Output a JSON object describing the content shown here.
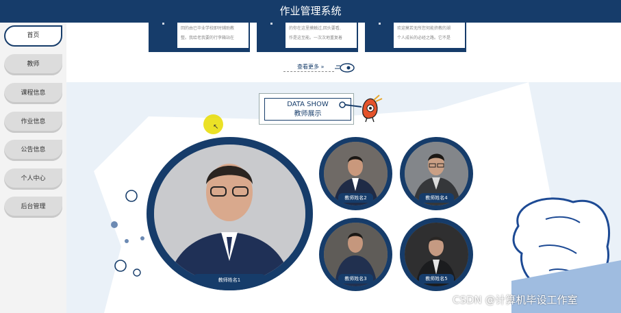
{
  "header": {
    "title": "作业管理系统"
  },
  "sidebar": {
    "items": [
      {
        "label": "首页",
        "active": true
      },
      {
        "label": "教师",
        "active": false
      },
      {
        "label": "课程信息",
        "active": false
      },
      {
        "label": "作业信息",
        "active": false
      },
      {
        "label": "公告信息",
        "active": false
      },
      {
        "label": "个人中心",
        "active": false
      },
      {
        "label": "后台管理",
        "active": false
      }
    ]
  },
  "news": {
    "cards": [
      {
        "lines": [
          "回的由已毕业学校即时辅助教",
          "整。我给老我要的行李箱站在"
        ]
      },
      {
        "lines": [
          "的你在这里摸触过,回头要看,",
          "作是这至能。一次次地重复着"
        ]
      },
      {
        "lines": [
          "欢迎莫若无所您何能挤教的湖",
          "个人成长的必经之路。它不是"
        ]
      }
    ],
    "more_label": "查看更多 »"
  },
  "showcase": {
    "title_en": "DATA SHOW",
    "title_cn": "教师展示",
    "teachers": [
      {
        "name": "教师姓名1"
      },
      {
        "name": "教师姓名2"
      },
      {
        "name": "教师姓名3"
      },
      {
        "name": "教师姓名4"
      },
      {
        "name": "教师姓名5"
      }
    ]
  },
  "colors": {
    "primary": "#163c6a",
    "accent_bg": "#eaf1f8"
  },
  "watermark": "CSDN @计算机毕设工作室"
}
